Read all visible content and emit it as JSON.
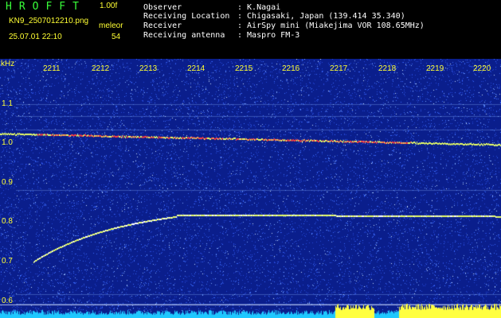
{
  "header": {
    "app_name": "HROFFT",
    "version": "1.00f",
    "filename": "KN9_2507012210.png",
    "datetime": "25.07.01 22:10",
    "mode": "meleor",
    "count": "54",
    "info": [
      {
        "label": "Observer",
        "value": ": K.Nagai"
      },
      {
        "label": "Receiving Location",
        "value": ": Chigasaki, Japan (139.414 35.340)"
      },
      {
        "label": "Receiver",
        "value": ": AirSpy mini (Miakejima VOR 108.65MHz)"
      },
      {
        "label": "Receiving antenna",
        "value": ": Maspro FM-3"
      }
    ]
  },
  "spectrogram": {
    "freq_unit": "kHz",
    "freq_labels": [
      "1.1",
      "1.0",
      "0.9",
      "0.8",
      "0.7",
      "0.6"
    ],
    "time_labels": [
      "2211",
      "2212",
      "2213",
      "2214",
      "2215",
      "2216",
      "2217",
      "2218",
      "2219",
      "2220"
    ],
    "colors": {
      "background": "#0a1e8c",
      "noise": "#3a6cff",
      "signal": "#e8ff66",
      "carrier": "#ff4040",
      "label": "#ffff33",
      "power_bar": "#1ec8ff",
      "power_bar_high": "#ffff40"
    }
  }
}
